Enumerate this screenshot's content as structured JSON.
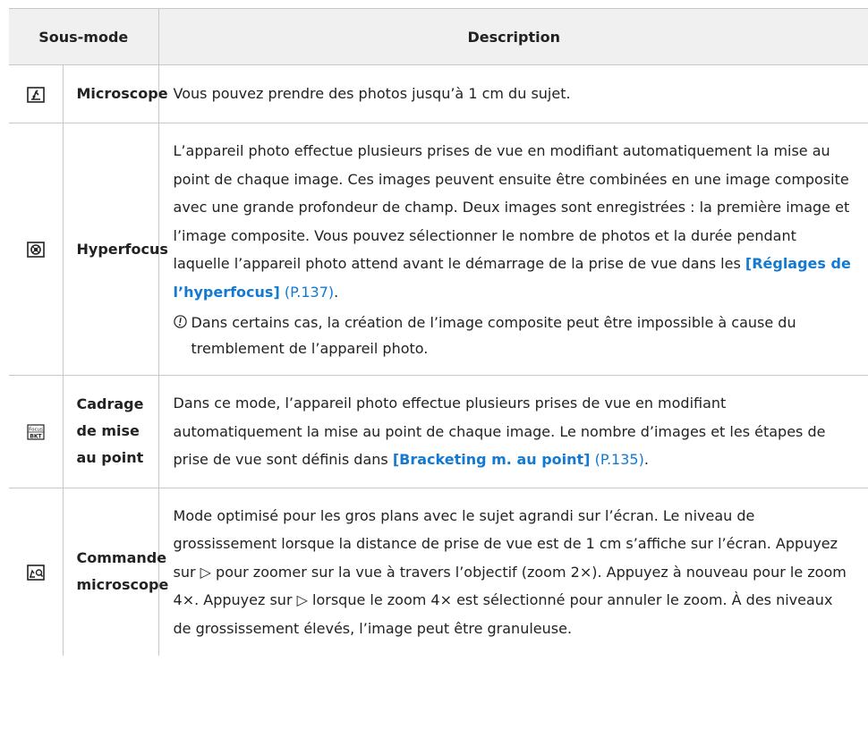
{
  "header": {
    "col_mode": "Sous-mode",
    "col_desc": "Description"
  },
  "rows": [
    {
      "icon": "microscope-mode-icon",
      "name": "Microscope",
      "desc": "Vous pouvez prendre des photos jusqu’à 1 cm du sujet."
    },
    {
      "icon": "hyperfocus-mode-icon",
      "name": "Hyperfocus",
      "desc": "L’appareil photo effectue plusieurs prises de vue en modifiant automatiquement la mise au point de chaque image. Ces images peuvent ensuite être combinées en une image composite avec une grande profondeur de champ. Deux images sont enregistrées : la première image et l’image composite. Vous pouvez sélectionner le nombre de photos et la durée pendant laquelle l’appareil photo attend avant le démarrage de la prise de vue dans les ",
      "link": "[Réglages de l’hyperfocus]",
      "ref": " (P.137)",
      "after": ".",
      "note": "Dans certains cas, la création de l’image composite peut être impossible à cause du tremblement de l’appareil photo."
    },
    {
      "icon": "focus-bkt-icon",
      "icon_text_top": "Focus",
      "icon_text_bottom": "BKT",
      "name": "Cadrage de mise au point",
      "desc": "Dans ce mode, l’appareil photo effectue plusieurs prises de vue en modifiant automatiquement la mise au point de chaque image. Le nombre d’images et les étapes de prise de vue sont définis dans ",
      "link": "[Bracketing m. au point]",
      "ref": " (P.135)",
      "after": "."
    },
    {
      "icon": "microscope-control-icon",
      "name": "Commande microscope",
      "desc_parts": [
        "Mode optimisé pour les gros plans avec le sujet agrandi sur l’écran. Le niveau de grossissement lorsque la distance de prise de vue est de 1 cm s’affiche sur l’écran. Appuyez sur ",
        " pour zoomer sur la vue à travers l’objectif (zoom 2×). Appuyez à nouveau pour le zoom 4×. Appuyez sur ",
        " lorsque le zoom 4× est sélectionné pour annuler le zoom. À des niveaux de grossissement élevés, l’image peut être granuleuse."
      ],
      "arrow": "▷"
    }
  ]
}
